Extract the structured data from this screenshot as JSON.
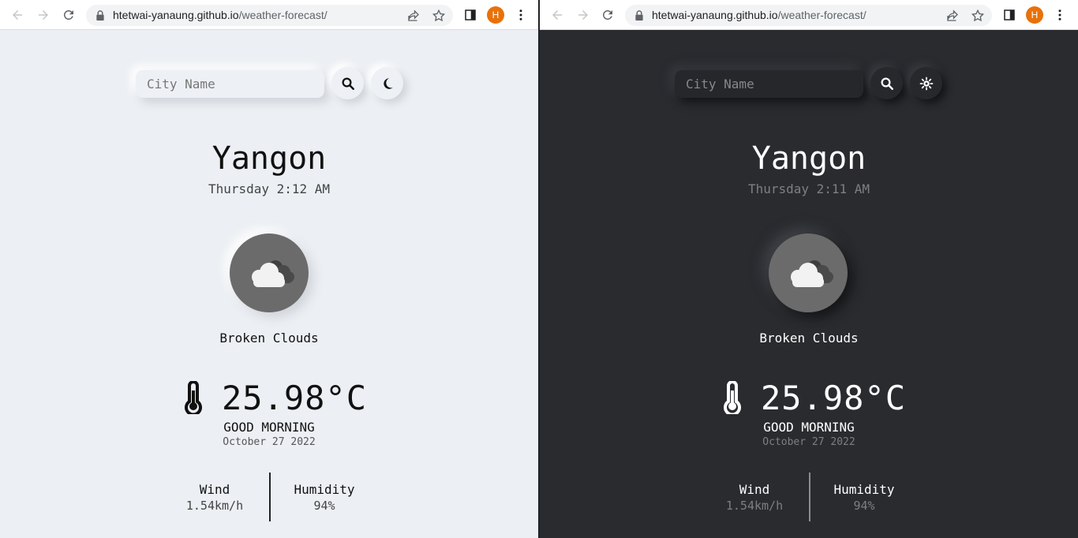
{
  "browser": {
    "url_host": "htetwai-yanaung.github.io",
    "url_path": "/weather-forecast/",
    "avatar_letter": "H"
  },
  "left_panel": {
    "theme": "light",
    "search_placeholder": "City Name",
    "theme_toggle_icon": "moon-icon",
    "city": "Yangon",
    "day_time": "Thursday 2:12 AM",
    "weather_icon": "broken-clouds-icon",
    "description": "Broken Clouds",
    "temperature": "25.98°C",
    "greeting": "GOOD MORNING",
    "date": "October 27 2022",
    "wind_label": "Wind",
    "wind_value": "1.54km/h",
    "humidity_label": "Humidity",
    "humidity_value": "94%"
  },
  "right_panel": {
    "theme": "dark",
    "search_placeholder": "City Name",
    "theme_toggle_icon": "sun-icon",
    "city": "Yangon",
    "day_time": "Thursday 2:11 AM",
    "weather_icon": "broken-clouds-icon",
    "description": "Broken Clouds",
    "temperature": "25.98°C",
    "greeting": "GOOD MORNING",
    "date": "October 27 2022",
    "wind_label": "Wind",
    "wind_value": "1.54km/h",
    "humidity_label": "Humidity",
    "humidity_value": "94%"
  },
  "colors": {
    "light_bg": "#eceff3",
    "dark_bg": "#292b2f",
    "avatar": "#e8710a",
    "weather_circle": "#6b6b6b"
  }
}
